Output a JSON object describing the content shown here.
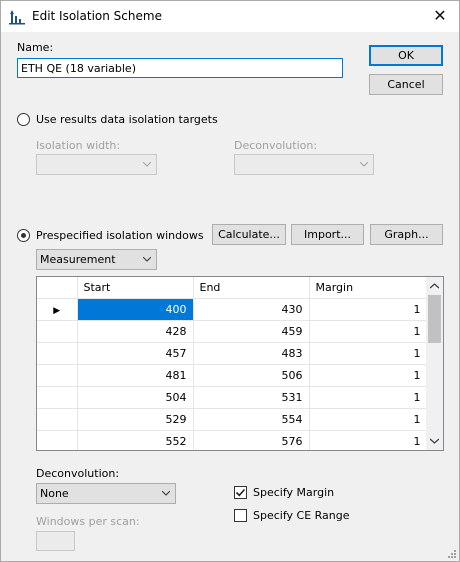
{
  "window": {
    "title": "Edit Isolation Scheme",
    "close_glyph": "✕"
  },
  "name_field": {
    "label": "Name:",
    "value": "ETH QE (18 variable)"
  },
  "buttons": {
    "ok": "OK",
    "cancel": "Cancel",
    "calculate": "Calculate...",
    "import": "Import...",
    "graph": "Graph..."
  },
  "results_option": {
    "label": "Use results data isolation targets",
    "checked": false,
    "isolation_width_label": "Isolation width:",
    "deconvolution_label": "Deconvolution:"
  },
  "prespecified_option": {
    "label": "Prespecified isolation windows",
    "checked": true,
    "mode_select": "Measurement"
  },
  "grid": {
    "columns": [
      "Start",
      "End",
      "Margin"
    ],
    "rows": [
      [
        "400",
        "430",
        "1"
      ],
      [
        "428",
        "459",
        "1"
      ],
      [
        "457",
        "483",
        "1"
      ],
      [
        "481",
        "506",
        "1"
      ],
      [
        "504",
        "531",
        "1"
      ],
      [
        "529",
        "554",
        "1"
      ],
      [
        "552",
        "576",
        "1"
      ]
    ],
    "current_row_marker": "▶"
  },
  "bottom": {
    "deconvolution_label": "Deconvolution:",
    "deconvolution_value": "None",
    "windows_per_scan_label": "Windows per scan:",
    "specify_margin_label": "Specify Margin",
    "specify_margin_checked": true,
    "specify_ce_label": "Specify CE Range",
    "specify_ce_checked": false
  },
  "icons": {
    "title": "skyline-chart-icon",
    "close": "close-icon",
    "dropdown": "chevron-down-icon",
    "scroll_up": "chevron-up-icon",
    "scroll_down": "chevron-down-icon",
    "resize": "resize-grip-icon"
  },
  "colors": {
    "accent": "#0078d7",
    "dialog_bg": "#f0f0f0",
    "disabled_text": "#a0a0a0"
  }
}
